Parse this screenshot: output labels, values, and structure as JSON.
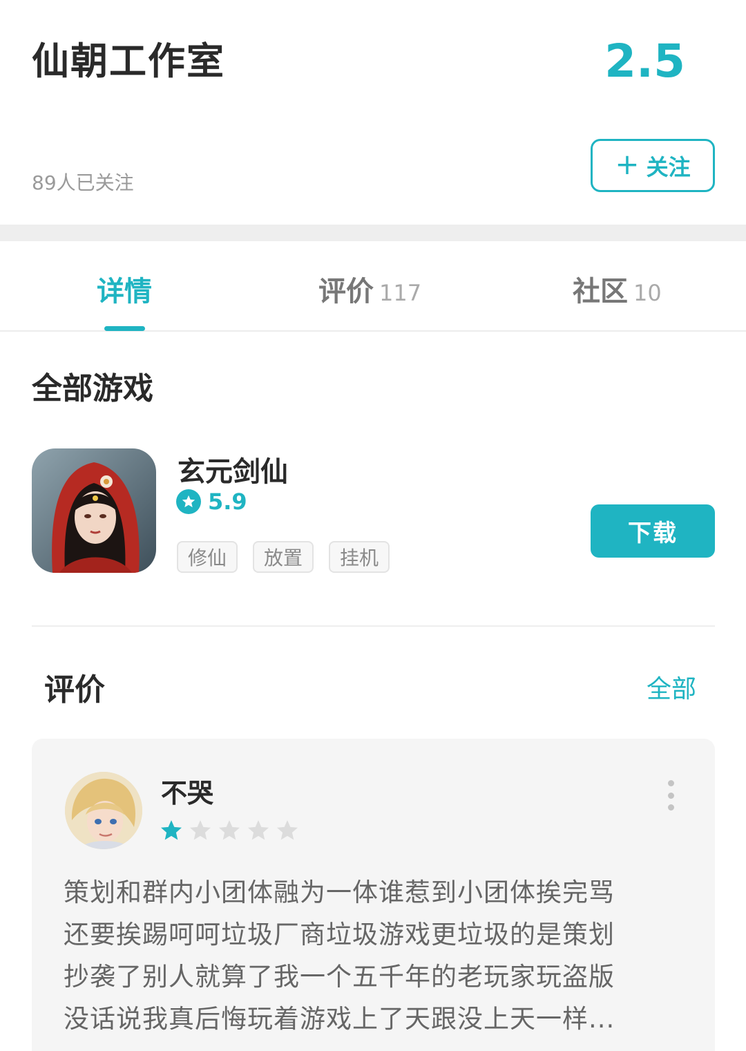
{
  "header": {
    "studio_name": "仙朝工作室",
    "score": "2.5",
    "followers": "89人已关注",
    "follow_button": "关注"
  },
  "tabs": [
    {
      "label": "详情",
      "count": "",
      "active": true
    },
    {
      "label": "评价",
      "count": "117",
      "active": false
    },
    {
      "label": "社区",
      "count": "10",
      "active": false
    }
  ],
  "games_section": {
    "title": "全部游戏",
    "game": {
      "name": "玄元剑仙",
      "rating": "5.9",
      "tags": [
        "修仙",
        "放置",
        "挂机"
      ],
      "download_label": "下载"
    }
  },
  "reviews_section": {
    "title": "评价",
    "all_label": "全部",
    "review": {
      "username": "不哭",
      "stars": 1,
      "max_stars": 5,
      "text_lines": [
        "策划和群内小团体融为一体谁惹到小团体挨完骂",
        "还要挨踢呵呵垃圾厂商垃圾游戏更垃圾的是策划",
        "抄袭了别人就算了我一个五千年的老玩家玩盗版",
        "没话说我真后悔玩着游戏上了天跟没上天一样..."
      ]
    }
  },
  "colors": {
    "accent": "#1fb4c2",
    "card_bg": "#f5f5f5",
    "star_off": "#dcdcdc"
  },
  "icons": [
    "plus-icon",
    "star-badge-icon",
    "star-icon",
    "more-vertical-icon"
  ]
}
